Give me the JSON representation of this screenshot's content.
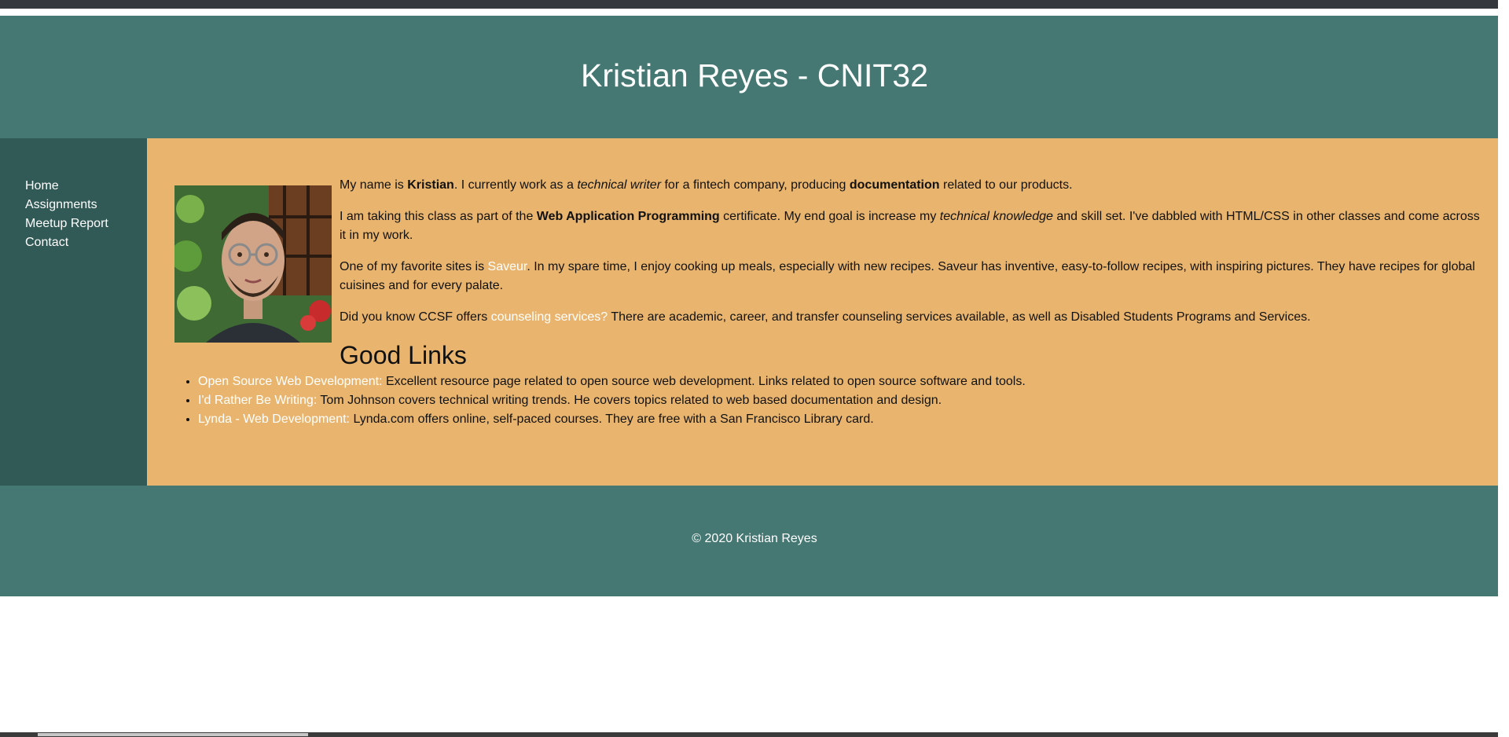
{
  "header": {
    "title": "Kristian Reyes - CNIT32"
  },
  "nav": {
    "items": [
      {
        "label": "Home"
      },
      {
        "label": "Assignments"
      },
      {
        "label": "Meetup Report"
      },
      {
        "label": "Contact"
      }
    ]
  },
  "main": {
    "intro": {
      "part1": "My name is ",
      "name_bold": "Kristian",
      "part2": ". I currently work as a ",
      "job_italic": "technical writer",
      "part3": " for a fintech company, producing ",
      "doc_bold": "documentation",
      "part4": " related to our products."
    },
    "class_para": {
      "part1": "I am taking this class as part of the ",
      "cert_bold": "Web Application Programming",
      "part2": " certificate. My end goal is increase my ",
      "goal_italic": "technical knowledge",
      "part3": " and skill set. I've dabbled with HTML/CSS in other classes and come across it in my work."
    },
    "favorite_para": {
      "part1": "One of my favorite sites is ",
      "link": "Saveur",
      "part2": ". In my spare time, I enjoy cooking up meals, especially with new recipes. Saveur has inventive, easy-to-follow recipes, with inspiring pictures. They have recipes for global cuisines and for every palate."
    },
    "ccsf_para": {
      "part1": "Did you know CCSF offers ",
      "link": "counseling services?",
      "part2": " There are academic, career, and transfer counseling services available, as well as Disabled Students Programs and Services."
    },
    "links_heading": "Good Links",
    "links": [
      {
        "label": "Open Source Web Development:",
        "desc": " Excellent resource page related to open source web development. Links related to open source software and tools."
      },
      {
        "label": "I'd Rather Be Writing:",
        "desc": " Tom Johnson covers technical writing trends. He covers topics related to web based documentation and design."
      },
      {
        "label": "Lynda - Web Development:",
        "desc": " Lynda.com offers online, self-paced courses. They are free with a San Francisco Library card."
      }
    ]
  },
  "footer": {
    "copyright": "© 2020 Kristian Reyes"
  },
  "colors": {
    "header_bg": "#457873",
    "nav_bg": "#315955",
    "main_bg": "#e9b56e",
    "link": "#ffffff"
  }
}
